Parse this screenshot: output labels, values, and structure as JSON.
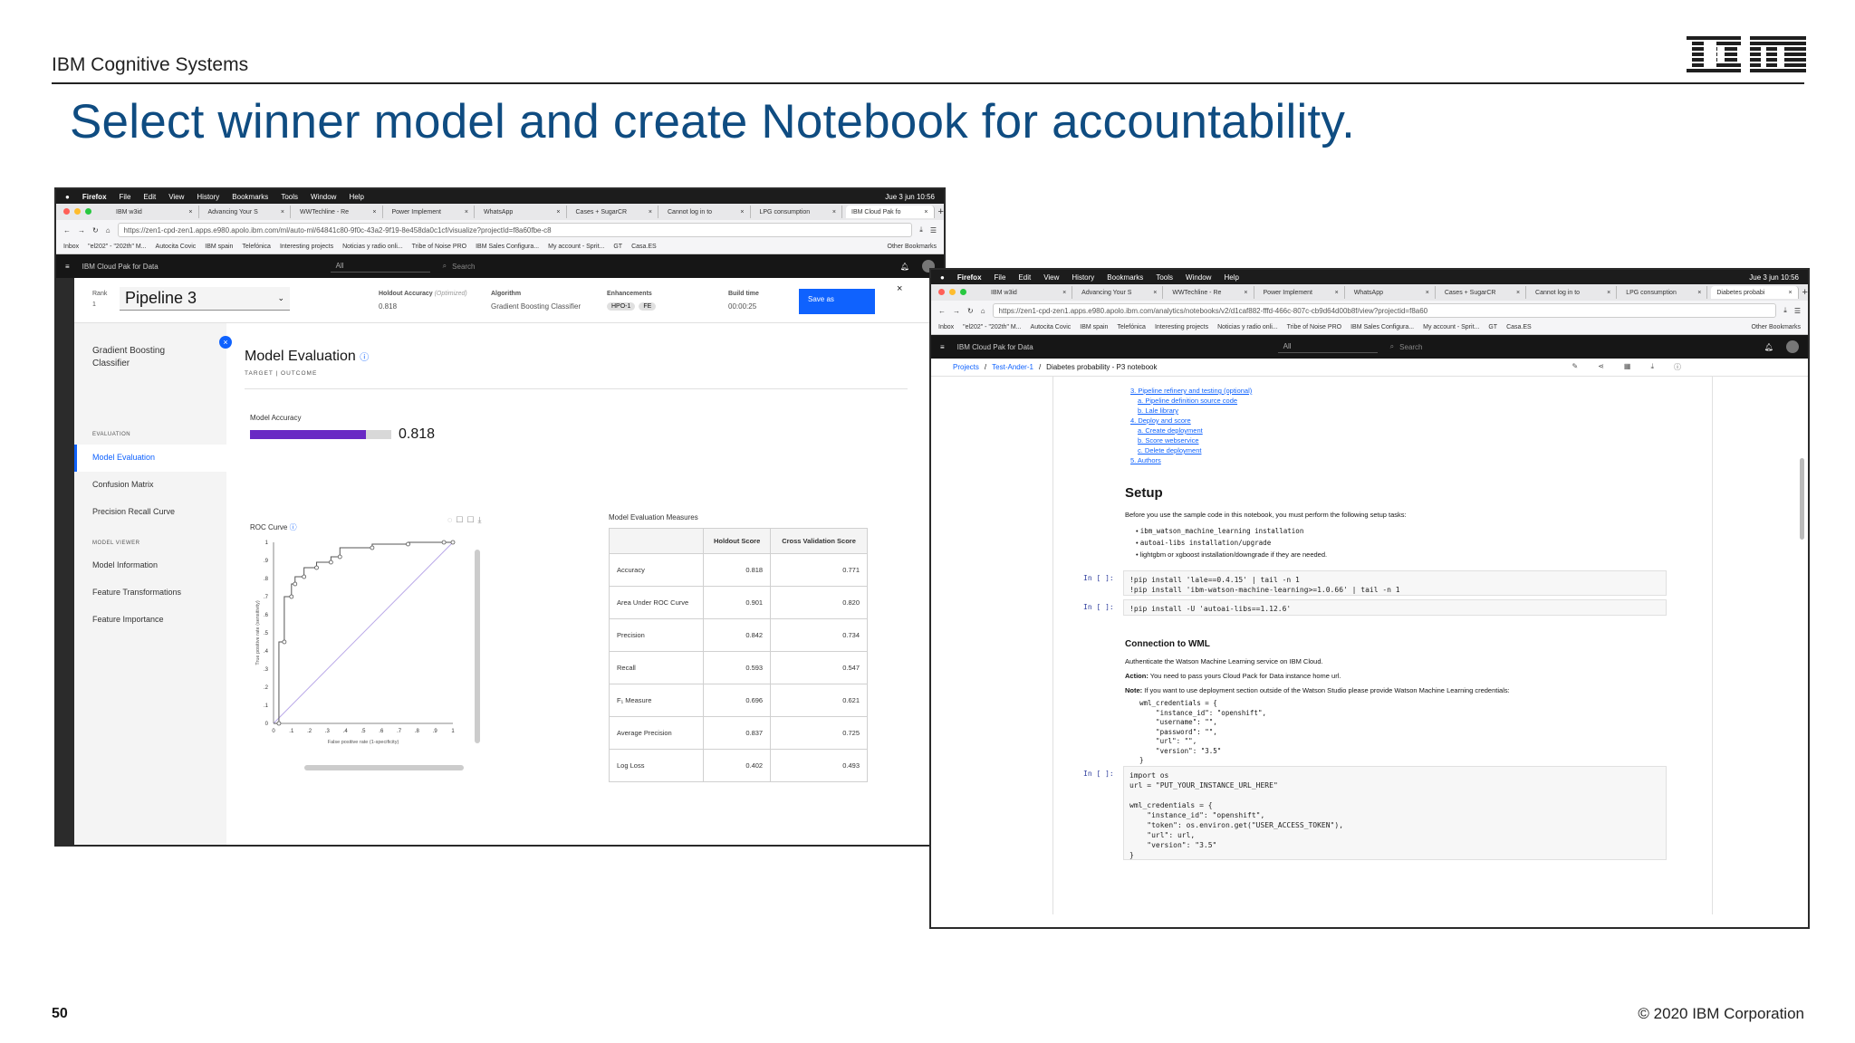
{
  "slide": {
    "brand": "IBM Cognitive Systems",
    "title": "Select winner model and create Notebook for accountability.",
    "page_number": "50",
    "copyright": "© 2020 IBM Corporation",
    "logo_text": "IBM"
  },
  "left_window": {
    "menubar": [
      "Firefox",
      "File",
      "Edit",
      "View",
      "History",
      "Bookmarks",
      "Tools",
      "Window",
      "Help"
    ],
    "clock": "Jue 3 jun  10:56",
    "tabs": [
      "IBM w3id",
      "Advancing Your S",
      "WWTechline - Re",
      "Power Implement",
      "WhatsApp",
      "Cases + SugarCR",
      "Cannot log in to",
      "LPG consumption",
      "IBM Cloud Pak fo"
    ],
    "url": "https://zen1-cpd-zen1.apps.e980.apolo.ibm.com/ml/auto-ml/64841c80-9f0c-43a2-9f19-8e458da0c1cf/visualize?projectId=f8a60fbe-c8",
    "bookmarks": [
      "Inbox",
      "\"el202\" - \"202th\" M...",
      "Autocita Covic",
      "IBM spain",
      "Telefónica",
      "Interesting projects",
      "Noticias y radio onli...",
      "Tribe of Noise PRO",
      "IBM Sales Configura...",
      "My account - Sprit...",
      "GT",
      "Casa.ES",
      "Other Bookmarks"
    ],
    "product": "IBM Cloud Pak for Data",
    "scope": "All",
    "search_placeholder": "Search",
    "rank_label": "Rank",
    "rank_value": "1",
    "pipeline": "Pipeline 3",
    "holdout_label": "Holdout Accuracy",
    "holdout_note": "(Optimized)",
    "holdout_value": "0.818",
    "algorithm_label": "Algorithm",
    "algorithm_value": "Gradient Boosting Classifier",
    "enhancements_label": "Enhancements",
    "enh1": "HPO-1",
    "enh2": "FE",
    "build_label": "Build time",
    "build_value": "00:00:25",
    "save_as": "Save as",
    "side_model": "Gradient Boosting Classifier",
    "side_eval_head": "EVALUATION",
    "side_items_eval": [
      "Model Evaluation",
      "Confusion Matrix",
      "Precision Recall Curve"
    ],
    "side_viewer_head": "MODEL VIEWER",
    "side_items_viewer": [
      "Model Information",
      "Feature Transformations",
      "Feature Importance"
    ],
    "eval_title": "Model Evaluation",
    "eval_sub": "TARGET | OUTCOME",
    "accuracy_label": "Model Accuracy",
    "accuracy_value": "0.818",
    "accuracy_fraction": 0.818,
    "roc_title": "ROC Curve",
    "roc_xlabel": "False positive rate (1-specificity)",
    "roc_ylabel": "True positive rate (sensitivity)",
    "measures_title": "Model Evaluation Measures",
    "measures_headers": [
      "",
      "Holdout Score",
      "Cross Validation Score"
    ],
    "measures": [
      [
        "Accuracy",
        "0.818",
        "0.771"
      ],
      [
        "Area Under ROC Curve",
        "0.901",
        "0.820"
      ],
      [
        "Precision",
        "0.842",
        "0.734"
      ],
      [
        "Recall",
        "0.593",
        "0.547"
      ],
      [
        "F₁ Measure",
        "0.696",
        "0.621"
      ],
      [
        "Average Precision",
        "0.837",
        "0.725"
      ],
      [
        "Log Loss",
        "0.402",
        "0.493"
      ]
    ]
  },
  "chart_data": {
    "type": "line",
    "title": "ROC Curve",
    "xlabel": "False positive rate (1-specificity)",
    "ylabel": "True positive rate (sensitivity)",
    "xlim": [
      0,
      1
    ],
    "ylim": [
      0,
      1
    ],
    "x_ticks": [
      "0",
      ".1",
      ".2",
      ".3",
      ".4",
      ".5",
      ".6",
      ".7",
      ".8",
      ".9",
      "1"
    ],
    "y_ticks": [
      "0",
      ".1",
      ".2",
      ".3",
      ".4",
      ".5",
      ".6",
      ".7",
      ".8",
      ".9",
      "1"
    ],
    "series": [
      {
        "name": "",
        "x": [
          0,
          0.03,
          0.03,
          0.06,
          0.06,
          0.1,
          0.1,
          0.12,
          0.12,
          0.17,
          0.17,
          0.24,
          0.24,
          0.32,
          0.32,
          0.37,
          0.37,
          0.55,
          0.55,
          0.75,
          0.75,
          0.95,
          1
        ],
        "y": [
          0,
          0,
          0.45,
          0.45,
          0.7,
          0.7,
          0.77,
          0.77,
          0.81,
          0.81,
          0.86,
          0.86,
          0.89,
          0.89,
          0.92,
          0.92,
          0.97,
          0.97,
          0.99,
          0.99,
          1,
          1,
          1
        ]
      },
      {
        "name": "",
        "x": [
          0,
          1
        ],
        "y": [
          0,
          1
        ]
      }
    ]
  },
  "right_window": {
    "menubar": [
      "Firefox",
      "File",
      "Edit",
      "View",
      "History",
      "Bookmarks",
      "Tools",
      "Window",
      "Help"
    ],
    "clock": "Jue 3 jun  10:56",
    "tabs": [
      "IBM w3id",
      "Advancing Your S",
      "WWTechline - Re",
      "Power Implement",
      "WhatsApp",
      "Cases + SugarCR",
      "Cannot log in to",
      "LPG consumption",
      "Diabetes probabi"
    ],
    "url": "https://zen1-cpd-zen1.apps.e980.apolo.ibm.com/analytics/notebooks/v2/d1caf882-fffd-466c-807c-cb9d64d00b8f/view?projectid=f8a60",
    "product": "IBM Cloud Pak for Data",
    "scope": "All",
    "search_placeholder": "Search",
    "breadcrumb": [
      "Projects",
      "Test-Ander-1",
      "Diabetes probability - P3 notebook"
    ],
    "toc": [
      "3. Pipeline refinery and testing (optional)",
      "a. Pipeline definition source code",
      "b. Lale library",
      "4. Deploy and score",
      "a. Create deployment",
      "b. Score webservice",
      "c. Delete deployment",
      "5. Authors"
    ],
    "setup_title": "Setup",
    "setup_text": "Before you use the sample code in this notebook, you must perform the following setup tasks:",
    "setup_bullets": [
      "ibm_watson_machine_learning installation",
      "autoai-libs installation/upgrade",
      "lightgbm or xgboost installation/downgrade if they are needed."
    ],
    "prompt": "In [ ]:",
    "cell1_line1": "!pip install 'lale==0.4.15' | tail -n 1",
    "cell1_line2": "!pip install 'ibm-watson-machine-learning>=1.0.66' | tail -n 1",
    "cell2": "!pip install -U 'autoai-libs==1.12.6'",
    "wml_title": "Connection to WML",
    "wml_text": "Authenticate the Watson Machine Learning service on IBM Cloud.",
    "action_label": "Action:",
    "action_text": "You need to pass yours Cloud Pack for Data instance home url.",
    "note_label": "Note:",
    "note_text": "If you want to use deployment section outside of the Watson Studio please provide Watson Machine Learning credentials:",
    "creds_text": "wml_credentials = {\n    \"instance_id\": \"openshift\",\n    \"username\": \"\",\n    \"password\": \"\",\n    \"url\": \"\",\n    \"version\": \"3.5\"\n}",
    "cell3": "import os\nurl = \"PUT_YOUR_INSTANCE_URL_HERE\"\n\nwml_credentials = {\n    \"instance_id\": \"openshift\",\n    \"token\": os.environ.get(\"USER_ACCESS_TOKEN\"),\n    \"url\": url,\n    \"version\": \"3.5\"\n}"
  }
}
